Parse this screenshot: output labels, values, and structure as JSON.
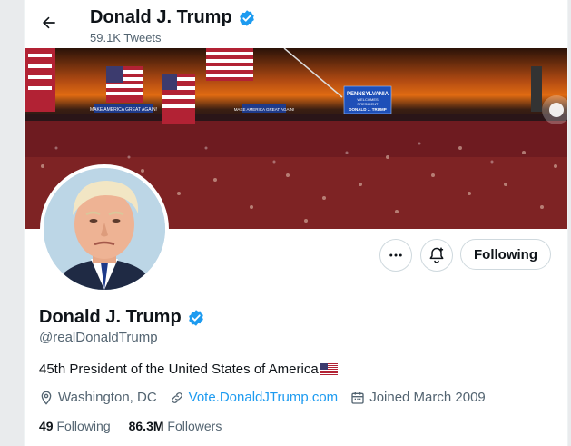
{
  "header": {
    "name": "Donald J. Trump",
    "tweet_count": "59.1K Tweets"
  },
  "banner": {
    "sign_line1": "PENNSYLVANIA",
    "sign_line2": "WELCOMES",
    "sign_line3": "PRESIDENT",
    "sign_line4": "DONALD J. TRUMP",
    "small_sign_left": "MAKE AMERICA GREAT AGAIN!",
    "small_sign_right": "MAKE AMERICA GREAT AGAIN!"
  },
  "actions": {
    "follow_label": "Following"
  },
  "profile": {
    "name": "Donald J. Trump",
    "handle": "@realDonaldTrump",
    "bio": "45th President of the United States of America",
    "location": "Washington, DC",
    "website": "Vote.DonaldJTrump.com",
    "joined": "Joined March 2009"
  },
  "stats": {
    "following_count": "49",
    "following_label": "Following",
    "followers_count": "86.3M",
    "followers_label": "Followers"
  },
  "colors": {
    "accent": "#1d9bf0",
    "secondary_text": "#536471",
    "border": "#cfd9de"
  }
}
